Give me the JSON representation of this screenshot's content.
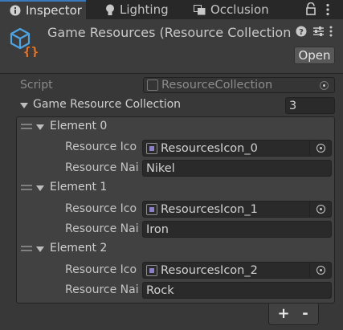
{
  "tabs": [
    {
      "label": "Inspector",
      "icon": "info-icon"
    },
    {
      "label": "Lighting",
      "icon": "lightbulb-icon"
    },
    {
      "label": "Occlusion",
      "icon": "occlusion-icon"
    }
  ],
  "header": {
    "title": "Game Resources (Resource Collection",
    "open_label": "Open",
    "icon": "scriptable-object-icon"
  },
  "script_row": {
    "label": "Script",
    "value": "ResourceCollection"
  },
  "collection": {
    "label": "Game Resource Collection",
    "size": "3"
  },
  "elements": [
    {
      "title": "Element 0",
      "icon_label": "Resource Ico",
      "icon_value": "ResourcesIcon_0",
      "name_label": "Resource Nai",
      "name_value": "Nikel"
    },
    {
      "title": "Element 1",
      "icon_label": "Resource Ico",
      "icon_value": "ResourcesIcon_1",
      "name_label": "Resource Nai",
      "name_value": "Iron"
    },
    {
      "title": "Element 2",
      "icon_label": "Resource Ico",
      "icon_value": "ResourcesIcon_2",
      "name_label": "Resource Nai",
      "name_value": "Rock"
    }
  ],
  "footer": {
    "add_label": "+",
    "remove_label": "-"
  },
  "colors": {
    "accent": "#3a79bb",
    "icon_blue": "#4ea3e0",
    "icon_orange": "#e8762b"
  }
}
